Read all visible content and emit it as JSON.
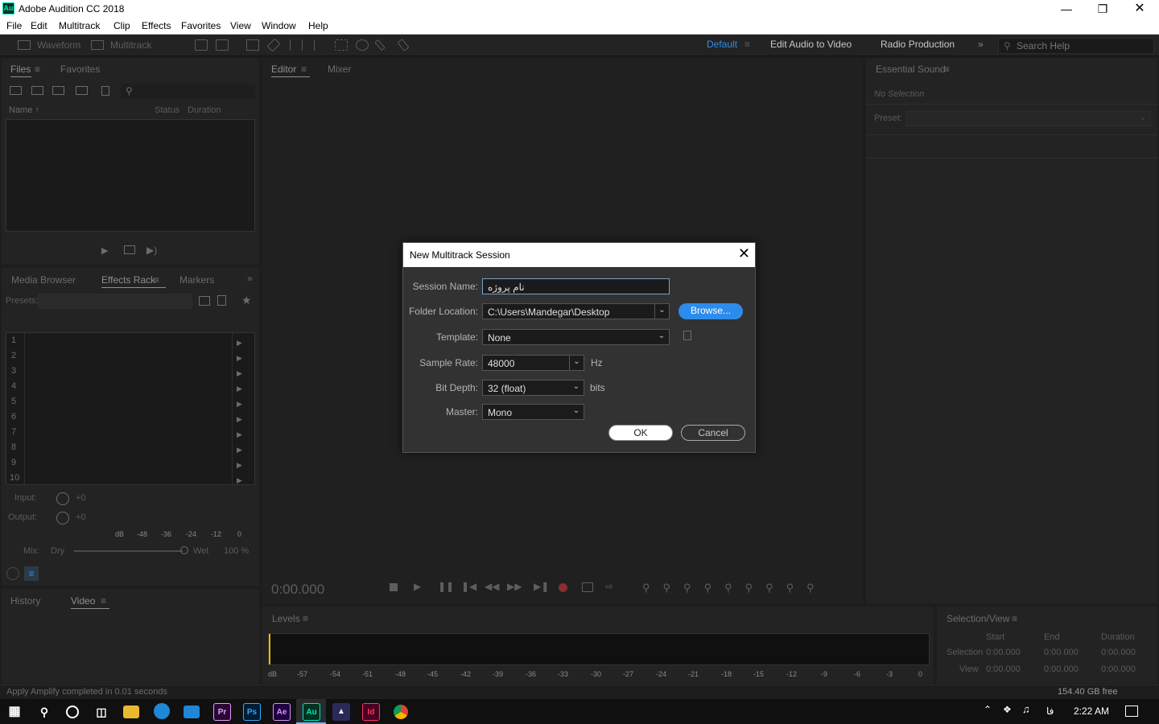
{
  "window": {
    "title": "Adobe Audition CC 2018",
    "app_icon": "Au"
  },
  "menu": [
    "File",
    "Edit",
    "Multitrack",
    "Clip",
    "Effects",
    "Favorites",
    "View",
    "Window",
    "Help"
  ],
  "toolbar": {
    "waveform": "Waveform",
    "multitrack": "Multitrack"
  },
  "workspaces": {
    "default": "Default",
    "edit_video": "Edit Audio to Video",
    "radio": "Radio Production"
  },
  "search": {
    "placeholder": "Search Help"
  },
  "files_panel": {
    "tab_files": "Files",
    "tab_favorites": "Favorites",
    "col_name": "Name",
    "col_status": "Status",
    "col_duration": "Duration"
  },
  "effects_panel": {
    "tab_media": "Media Browser",
    "tab_effects": "Effects Rack",
    "tab_markers": "Markers",
    "presets_label": "Presets:",
    "slots": [
      "1",
      "2",
      "3",
      "4",
      "5",
      "6",
      "7",
      "8",
      "9",
      "10"
    ],
    "input_label": "Input:",
    "input_value": "+0",
    "output_label": "Output:",
    "output_value": "+0",
    "meter_labels": [
      "dB",
      "-48",
      "-36",
      "-24",
      "-12",
      "0"
    ],
    "mix_label": "Mix:",
    "dry": "Dry",
    "wet": "Wet",
    "mix_pct": "100 %"
  },
  "history_panel": {
    "tab_history": "History",
    "tab_video": "Video"
  },
  "editor": {
    "tab_editor": "Editor",
    "tab_mixer": "Mixer",
    "time": "0:00.000"
  },
  "essential": {
    "title": "Essential Sound",
    "no_selection": "No Selection",
    "preset_label": "Preset:"
  },
  "levels": {
    "title": "Levels",
    "ticks": [
      "dB",
      "-57",
      "-54",
      "-51",
      "-48",
      "-45",
      "-42",
      "-39",
      "-36",
      "-33",
      "-30",
      "-27",
      "-24",
      "-21",
      "-18",
      "-15",
      "-12",
      "-9",
      "-6",
      "-3",
      "0"
    ]
  },
  "selection_view": {
    "title": "Selection/View",
    "col_start": "Start",
    "col_end": "End",
    "col_duration": "Duration",
    "rows": [
      {
        "label": "Selection",
        "start": "0:00.000",
        "end": "0:00.000",
        "duration": "0:00.000"
      },
      {
        "label": "View",
        "start": "0:00.000",
        "end": "0:00.000",
        "duration": "0:00.000"
      }
    ]
  },
  "status": {
    "message": "Apply Amplify completed in 0.01 seconds",
    "free_space": "154.40 GB free"
  },
  "dialog": {
    "title": "New Multitrack Session",
    "session_name_label": "Session Name:",
    "session_name_value": "نام پروژه",
    "folder_label": "Folder Location:",
    "folder_value": "C:\\Users\\Mandegar\\Desktop",
    "browse": "Browse...",
    "template_label": "Template:",
    "template_value": "None",
    "sample_rate_label": "Sample Rate:",
    "sample_rate_value": "48000",
    "sample_rate_unit": "Hz",
    "bit_depth_label": "Bit Depth:",
    "bit_depth_value": "32 (float)",
    "bit_depth_unit": "bits",
    "master_label": "Master:",
    "master_value": "Mono",
    "ok": "OK",
    "cancel": "Cancel"
  },
  "taskbar": {
    "time": "2:22 AM",
    "lang": "فا",
    "apps": [
      "Pr",
      "Ps",
      "Ae",
      "Au",
      "Id"
    ]
  },
  "colors": {
    "accent": "#2d8ceb",
    "workspace_active": "#2d8ceb",
    "record": "#c82828"
  }
}
